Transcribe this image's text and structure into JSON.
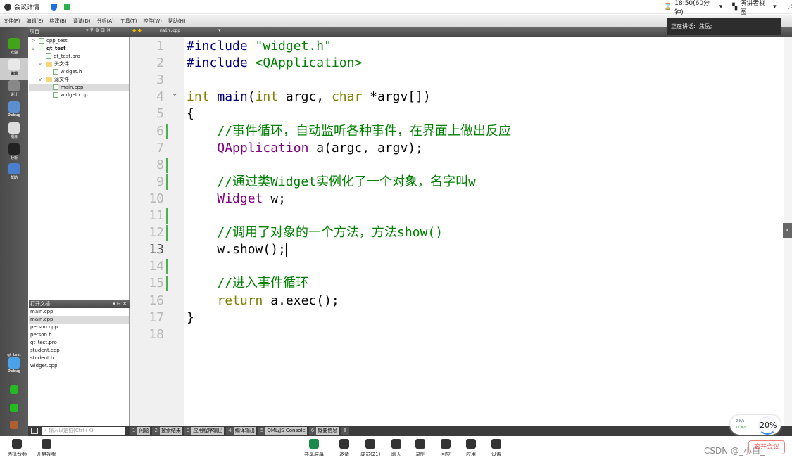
{
  "topbar": {
    "meeting_details": "会议详情",
    "time": "18:50(60分钟)",
    "presenter_view": "演讲者视图"
  },
  "speaking": {
    "label": "正在讲话:",
    "name": "焦岳;"
  },
  "menu": [
    "文件(F)",
    "编辑(E)",
    "构建(B)",
    "调试(D)",
    "分析(A)",
    "工具(T)",
    "控件(W)",
    "帮助(H)"
  ],
  "project_panel": {
    "title": "项目",
    "tree": [
      {
        "label": "cpp_test",
        "indent": 0,
        "expander": ">",
        "type": "project"
      },
      {
        "label": "qt_test",
        "indent": 0,
        "expander": "v",
        "type": "project",
        "bold": true
      },
      {
        "label": "qt_test.pro",
        "indent": 1,
        "type": "file"
      },
      {
        "label": "头文件",
        "indent": 1,
        "expander": "v",
        "type": "folder"
      },
      {
        "label": "widget.h",
        "indent": 2,
        "type": "file"
      },
      {
        "label": "源文件",
        "indent": 1,
        "expander": "v",
        "type": "folder"
      },
      {
        "label": "main.cpp",
        "indent": 2,
        "type": "file",
        "selected": true
      },
      {
        "label": "widget.cpp",
        "indent": 2,
        "type": "file"
      }
    ]
  },
  "editor_tab": {
    "file": "main.cpp"
  },
  "modes": [
    {
      "label": "欢迎",
      "color": "#41a317"
    },
    {
      "label": "编辑",
      "color": "#e8e8e8"
    },
    {
      "label": "设计",
      "color": "#888"
    },
    {
      "label": "Debug",
      "color": "#5a8fd0"
    },
    {
      "label": "项目",
      "color": "#ddd"
    },
    {
      "label": "分析",
      "color": "#222"
    },
    {
      "label": "帮助",
      "color": "#4a7fd0"
    }
  ],
  "kit": {
    "project": "qt_test",
    "config": "Debug"
  },
  "open_docs": {
    "title": "打开文档",
    "items": [
      "main.cpp",
      "main.cpp",
      "person.cpp",
      "person.h",
      "qt_test.pro",
      "student.cpp",
      "student.h",
      "widget.cpp"
    ],
    "selected": 1
  },
  "code": {
    "current_line": 13,
    "changed_lines": [
      6,
      8,
      9,
      11,
      12,
      14,
      15
    ],
    "lines": [
      [
        [
          "pre",
          "#include "
        ],
        [
          "str",
          "\"widget.h\""
        ]
      ],
      [
        [
          "pre",
          "#include "
        ],
        [
          "str",
          "<QApplication>"
        ]
      ],
      [],
      [
        [
          "kw",
          "int"
        ],
        [
          "pl",
          " "
        ],
        [
          "fn",
          "main"
        ],
        [
          "pl",
          "("
        ],
        [
          "kw",
          "int"
        ],
        [
          "pl",
          " argc, "
        ],
        [
          "kw",
          "char"
        ],
        [
          "pl",
          " *argv[])"
        ]
      ],
      [
        [
          "pl",
          "{"
        ]
      ],
      [
        [
          "pl",
          "    "
        ],
        [
          "cm",
          "//事件循环，自动监听各种事件，在界面上做出反应"
        ]
      ],
      [
        [
          "pl",
          "    "
        ],
        [
          "ty",
          "QApplication"
        ],
        [
          "pl",
          " a(argc, argv);"
        ]
      ],
      [],
      [
        [
          "pl",
          "    "
        ],
        [
          "cm",
          "//通过类Widget实例化了一个对象，名字叫w"
        ]
      ],
      [
        [
          "pl",
          "    "
        ],
        [
          "ty",
          "Widget"
        ],
        [
          "pl",
          " w;"
        ]
      ],
      [],
      [
        [
          "pl",
          "    "
        ],
        [
          "cm",
          "//调用了对象的一个方法，方法show()"
        ]
      ],
      [
        [
          "pl",
          "    w.show();"
        ]
      ],
      [],
      [
        [
          "pl",
          "    "
        ],
        [
          "cm",
          "//进入事件循环"
        ]
      ],
      [
        [
          "pl",
          "    "
        ],
        [
          "kw",
          "return"
        ],
        [
          "pl",
          " a.exec();"
        ]
      ],
      [
        [
          "pl",
          "}"
        ]
      ],
      []
    ]
  },
  "status": {
    "search_placeholder": "输入以定位(Ctrl+K)",
    "tabs": [
      {
        "n": "1",
        "l": "问题"
      },
      {
        "n": "2",
        "l": "搜索结果"
      },
      {
        "n": "3",
        "l": "应用程序输出"
      },
      {
        "n": "4",
        "l": "编译输出"
      },
      {
        "n": "5",
        "l": "QML/JS Console"
      },
      {
        "n": "6",
        "l": "概要信息"
      }
    ]
  },
  "network": {
    "up": "2 K/s",
    "down": "11 K/s",
    "cpu": "20%"
  },
  "meeting": {
    "left": [
      "选择音频",
      "开启视频"
    ],
    "center": [
      "共享屏幕",
      "邀请",
      "成员(21)",
      "聊天",
      "录制",
      "回应",
      "应用",
      "设置"
    ],
    "end": "离开会议",
    "watermark": "CSDN @_小白_"
  }
}
